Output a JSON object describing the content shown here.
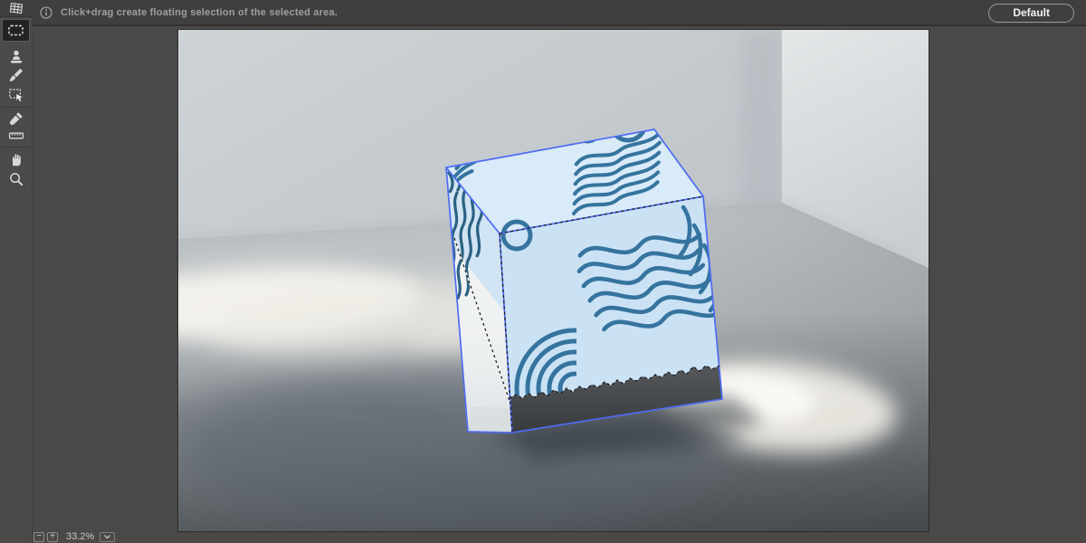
{
  "topbar": {
    "message": "Click+drag create floating selection of the selected area.",
    "default_button_label": "Default"
  },
  "toolbar": {
    "tools": [
      {
        "name": "grid-tool",
        "selected": false
      },
      {
        "name": "marquee-tool",
        "selected": true
      },
      {
        "name": "clone-stamp-tool",
        "selected": false
      },
      {
        "name": "brush-tool",
        "selected": false
      },
      {
        "name": "transform-selection-tool",
        "selected": false
      },
      {
        "name": "eyedropper-tool",
        "selected": false
      },
      {
        "name": "ruler-tool",
        "selected": false
      },
      {
        "name": "hand-tool",
        "selected": false
      },
      {
        "name": "zoom-tool",
        "selected": false
      }
    ]
  },
  "zoombar": {
    "zoom_out_label": "−",
    "zoom_in_label": "+",
    "zoom_level": "33.2%"
  },
  "scene": {
    "colors": {
      "selection_blue": "#4e6cf3",
      "cube_top": "#d9eaf8",
      "cube_front": "#cbe2f5",
      "cube_left": "#f3f5f5",
      "wave_stroke": "#35749e",
      "wave_stroke_dark": "#2b6183",
      "band_dark": "#45484a",
      "wall_back": "#c3c9cd",
      "wall_right": "#dadde0",
      "floor_highlight": "#f2efe9",
      "floor_shadow": "#5a6066"
    }
  }
}
